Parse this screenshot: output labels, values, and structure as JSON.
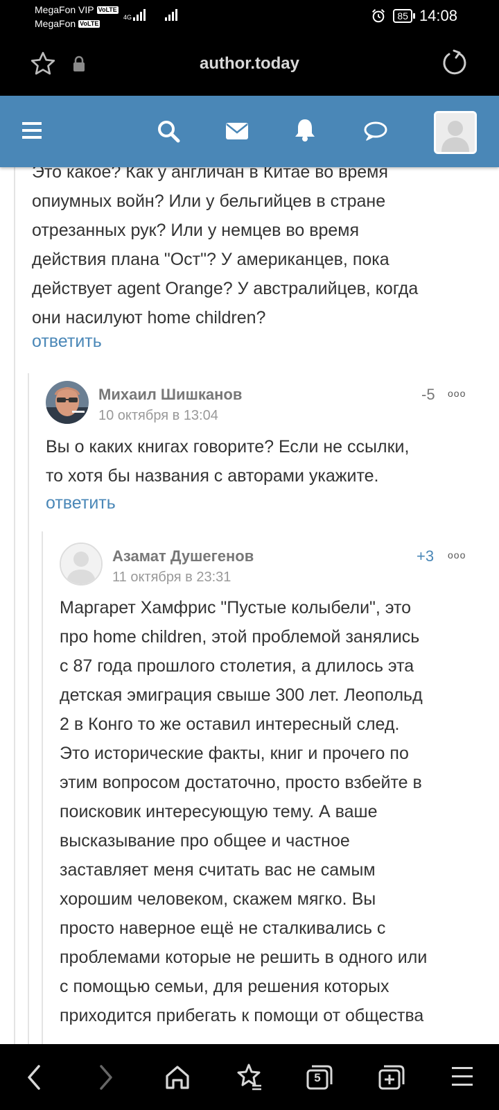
{
  "status_bar": {
    "carrier1": "MegaFon VIP",
    "carrier2": "MegaFon",
    "volte": "VoLTE",
    "network": "4G",
    "battery": "85",
    "time": "14:08"
  },
  "browser": {
    "url": "author.today"
  },
  "comments": [
    {
      "text_lines": [
        "Это какое? Как у англичан в Китае во время",
        "опиумных войн? Или у бельгийцев в стране",
        "отрезанных рук? Или у немцев во время",
        "действия плана \"Ост\"? У американцев, пока",
        "действует agent Orange? У австралийцев, когда",
        "они насилуют home children?"
      ],
      "reply_label": "ответить"
    },
    {
      "author": "Михаил Шишканов",
      "date": "10 октября в 13:04",
      "score": "-5",
      "text_lines": [
        "Вы о каких книгах говорите? Если не ссылки,",
        "то хотя бы названия с авторами укажите."
      ],
      "reply_label": "ответить"
    },
    {
      "author": "Азамат Душегенов",
      "date": "11 октября в 23:31",
      "score": "+3",
      "text_lines": [
        "Маргарет Хамфрис \"Пустые колыбели\", это",
        "про home children, этой проблемой занялись",
        "с 87 года прошлого столетия, а длилось эта",
        "детская эмиграция свыше 300 лет. Леопольд",
        "2 в Конго то же оставил интересный след.",
        "Это исторические факты, книг и прочего по",
        "этим вопросом достаточно, просто взбейте в",
        "поисковик интересующую тему. А ваше",
        "высказывание про общее и частное",
        "заставляет меня считать вас не самым",
        "хорошим человеком, скажем мягко. Вы",
        "просто наверное ещё не сталкивались с",
        "проблемами которые не решить в одного или",
        "с помощью семьи, для решения которых",
        "приходится прибегать к помощи от общества"
      ]
    }
  ],
  "more_label": "ooo",
  "tab_count": "5",
  "colors": {
    "brand": "#4a87b7",
    "negative": "#777777",
    "positive": "#4a87b7"
  }
}
